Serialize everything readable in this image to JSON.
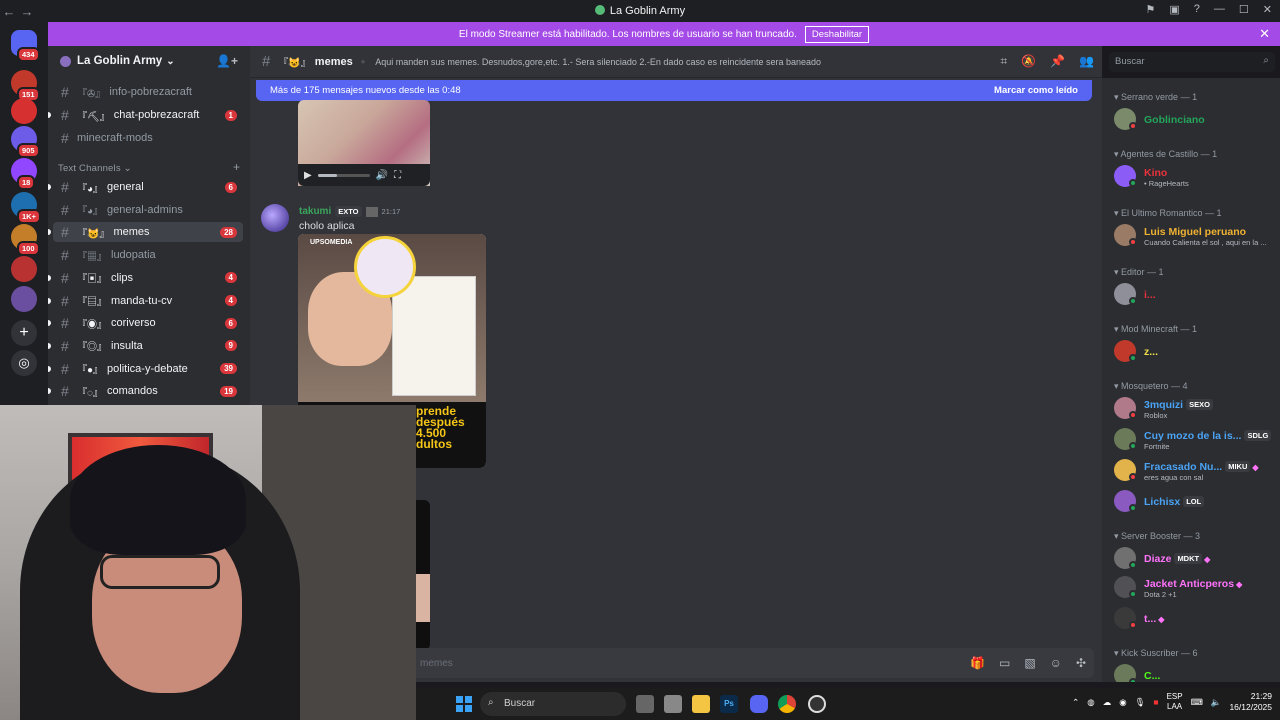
{
  "window": {
    "title": "La Goblin Army",
    "back": "←",
    "forward": "→"
  },
  "guilds": [
    {
      "badge": "434",
      "color": "#5865f2"
    },
    {
      "badge": "151",
      "color": "#c0392b"
    },
    {
      "badge": "",
      "color": "#d63031"
    },
    {
      "badge": "905",
      "color": "#6c5ce7"
    },
    {
      "badge": "18",
      "color": "#9146ff"
    },
    {
      "badge": "1K+",
      "color": "#1e6fb0"
    },
    {
      "badge": "100",
      "color": "#c47e2a"
    },
    {
      "badge": "",
      "color": "#b83232"
    },
    {
      "badge": "",
      "color": "#6a4fa0"
    }
  ],
  "streamer": {
    "text": "El modo Streamer está habilitado. Los nombres de usuario se han truncado.",
    "button": "Deshabilitar",
    "close": "✕"
  },
  "server": {
    "name": "La Goblin Army",
    "chevron": "⌄"
  },
  "channels_top": [
    {
      "prefix": "『✇』",
      "name": "info-pobrezacraft",
      "badge": ""
    },
    {
      "prefix": "『⛏』",
      "name": "chat-pobrezacraft",
      "badge": "1"
    },
    {
      "prefix": "",
      "name": "minecraft-mods",
      "badge": ""
    }
  ],
  "category": {
    "label": "Text Channels",
    "chevron": "⌄",
    "plus": "+"
  },
  "channels": [
    {
      "prefix": "『◕』",
      "name": "general",
      "badge": "6",
      "active": false
    },
    {
      "prefix": "『◕』",
      "name": "general-admins",
      "badge": "",
      "active": false
    },
    {
      "prefix": "『😺』",
      "name": "memes",
      "badge": "28",
      "active": true
    },
    {
      "prefix": "『▦』",
      "name": "ludopatia",
      "badge": "",
      "active": false
    },
    {
      "prefix": "『▣』",
      "name": "clips",
      "badge": "4",
      "active": false
    },
    {
      "prefix": "『▤』",
      "name": "manda-tu-cv",
      "badge": "4",
      "active": false
    },
    {
      "prefix": "『◉』",
      "name": "coriverso",
      "badge": "6",
      "active": false
    },
    {
      "prefix": "『◎』",
      "name": "insulta",
      "badge": "9",
      "active": false
    },
    {
      "prefix": "『●』",
      "name": "politica-y-debate",
      "badge": "39",
      "active": false
    },
    {
      "prefix": "『◌』",
      "name": "comandos",
      "badge": "19",
      "active": false
    }
  ],
  "header": {
    "prefix": "『😺』",
    "channel": "memes",
    "sep": "•",
    "topic": "Aqui manden sus memes. Desnudos,gore,etc. 1.- Sera silenciado 2.-En dado caso es reincidente sera baneado",
    "search_placeholder": "Buscar"
  },
  "newbar": {
    "text": "Más de 175 mensajes nuevos desde las 0:48",
    "action": "Marcar como leído"
  },
  "video": {
    "progress": 0.38,
    "play": "▶",
    "volume": "🔊",
    "fullscreen": "⛶"
  },
  "message": {
    "author": "takumi",
    "tag": "EXTO",
    "time": "21:17",
    "text": "cholo aplica"
  },
  "meme": {
    "brand": "UPSOMEDIA",
    "caption": "prende\ndespués\n4.500\ndultos"
  },
  "composer": {
    "placeholder": "memes"
  },
  "members": [
    {
      "type": "role",
      "label": "Serrano verde — 1"
    },
    {
      "type": "member",
      "name": "Goblinciano",
      "color": "#23a55a",
      "status": "",
      "tag": "",
      "boost": false,
      "dnd": true
    },
    {
      "type": "role",
      "label": "Agentes de Castillo — 1"
    },
    {
      "type": "member",
      "name": "Kino",
      "color": "#e8323c",
      "status": "• RageHearts",
      "tag": "",
      "boost": false,
      "dnd": false
    },
    {
      "type": "role",
      "label": "El Ultimo Romantico — 1"
    },
    {
      "type": "member",
      "name": "Luis Miguel peruano",
      "color": "#f0b232",
      "status": "Cuando Calienta el sol , aqui en la ...",
      "tag": "",
      "boost": false,
      "dnd": true
    },
    {
      "type": "role",
      "label": "Editor — 1"
    },
    {
      "type": "member",
      "name": "i...",
      "color": "#e8323c",
      "status": "",
      "tag": "",
      "boost": false,
      "dnd": false
    },
    {
      "type": "role",
      "label": "Mod Minecraft — 1"
    },
    {
      "type": "member",
      "name": "z...",
      "color": "#f0e04a",
      "status": "",
      "tag": "",
      "boost": false,
      "dnd": false
    },
    {
      "type": "role",
      "label": "Mosquetero — 4"
    },
    {
      "type": "member",
      "name": "3mquizi",
      "color": "#4aa3f5",
      "status": "Roblox",
      "tag": "SEXO",
      "boost": false,
      "dnd": true
    },
    {
      "type": "member",
      "name": "Cuy mozo de la is...",
      "color": "#4aa3f5",
      "status": "Fortnite",
      "tag": "SDLG",
      "boost": false,
      "dnd": false
    },
    {
      "type": "member",
      "name": "Fracasado Nu...",
      "color": "#4aa3f5",
      "status": "eres agua con sal",
      "tag": "MIKU",
      "boost": true,
      "dnd": true
    },
    {
      "type": "member",
      "name": "Lichisx",
      "color": "#4aa3f5",
      "status": "",
      "tag": "LOL",
      "boost": false,
      "dnd": false
    },
    {
      "type": "role",
      "label": "Server Booster — 3"
    },
    {
      "type": "member",
      "name": "Diaze",
      "color": "#ff73fa",
      "status": "",
      "tag": "MDKT",
      "boost": true,
      "dnd": false
    },
    {
      "type": "member",
      "name": "Jacket Anticperos",
      "color": "#ff73fa",
      "status": "Dota 2 +1",
      "tag": "",
      "boost": true,
      "dnd": false
    },
    {
      "type": "member",
      "name": "t...",
      "color": "#ff73fa",
      "status": "",
      "tag": "",
      "boost": true,
      "dnd": true
    },
    {
      "type": "role",
      "label": "Kick Suscriber — 6"
    },
    {
      "type": "member",
      "name": "C...",
      "color": "#53fc18",
      "status": "",
      "tag": "",
      "boost": false,
      "dnd": false
    }
  ],
  "taskbar": {
    "search": "Buscar",
    "lang1": "ESP",
    "lang2": "LAA",
    "time": "21:29",
    "date": "16/12/2025"
  }
}
